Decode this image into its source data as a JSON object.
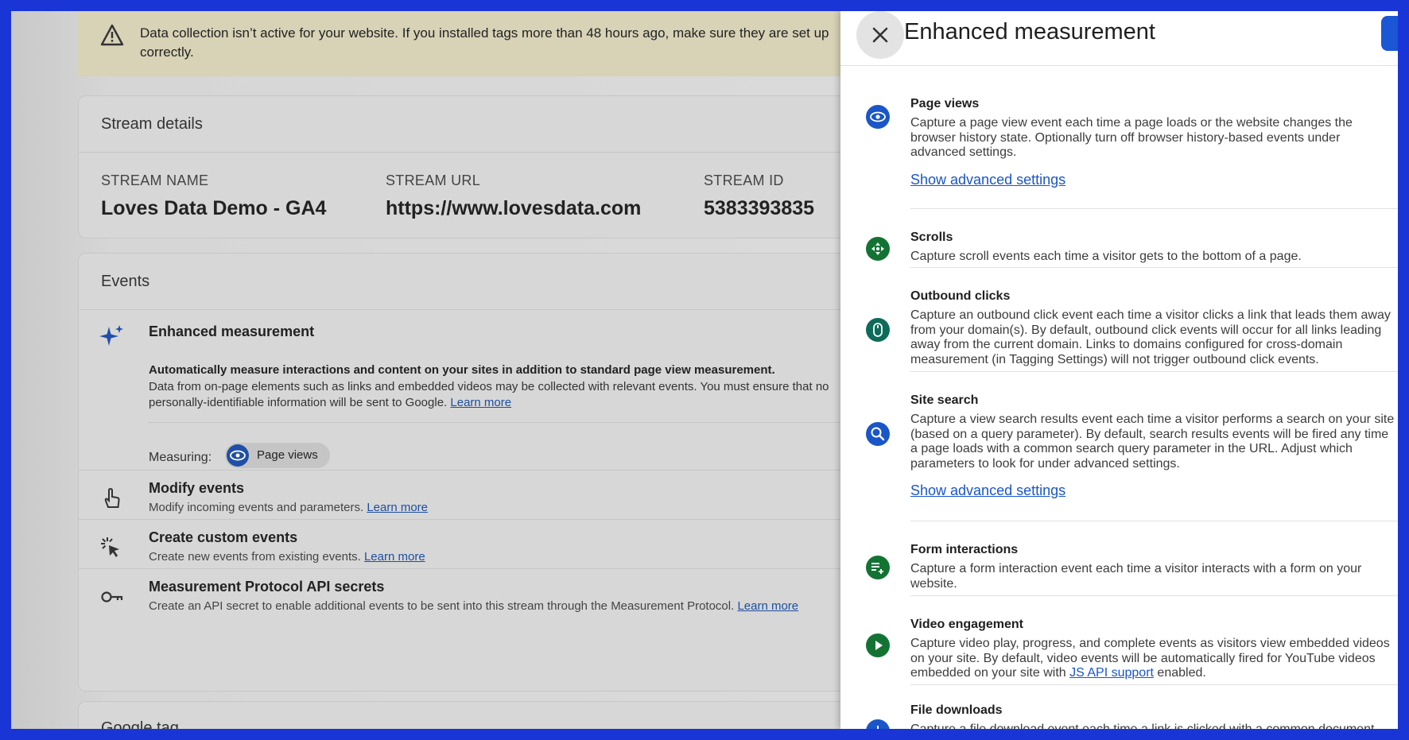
{
  "warning": {
    "text": "Data collection isn’t active for your website. If you installed tags more than 48 hours ago, make sure they are set up correctly."
  },
  "stream_details": {
    "title": "Stream details",
    "name_label": "STREAM NAME",
    "name_value": "Loves Data Demo - GA4",
    "url_label": "STREAM URL",
    "url_value": "https://www.lovesdata.com",
    "id_label": "STREAM ID",
    "id_value": "5383393835"
  },
  "events": {
    "title": "Events",
    "enhanced": {
      "title": "Enhanced measurement",
      "desc_bold": "Automatically measure interactions and content on your sites in addition to standard page view measurement.",
      "desc": "Data from on-page elements such as links and embedded videos may be collected with relevant events. You must ensure that no personally-identifiable information will be sent to Google.",
      "learn_more": "Learn more",
      "measuring_label": "Measuring:",
      "chip_label": "Page views"
    },
    "rows": [
      {
        "title": "Modify events",
        "desc": "Modify incoming events and parameters.",
        "link": "Learn more"
      },
      {
        "title": "Create custom events",
        "desc": "Create new events from existing events.",
        "link": "Learn more"
      },
      {
        "title": "Measurement Protocol API secrets",
        "desc": "Create an API secret to enable additional events to be sent into this stream through the Measurement Protocol.",
        "link": "Learn more"
      }
    ]
  },
  "google_tag": {
    "title": "Google tag"
  },
  "panel": {
    "title": "Enhanced measurement",
    "advanced_label": "Show advanced settings",
    "items": [
      {
        "title": "Page views",
        "desc": "Capture a page view event each time a page loads or the website changes the browser history state. Optionally turn off browser history-based events under advanced settings.",
        "icon": "eye-icon"
      },
      {
        "title": "Scrolls",
        "desc": "Capture scroll events each time a visitor gets to the bottom of a page.",
        "icon": "scroll-icon"
      },
      {
        "title": "Outbound clicks",
        "desc": "Capture an outbound click event each time a visitor clicks a link that leads them away from your domain(s). By default, outbound click events will occur for all links leading away from the current domain. Links to domains configured for cross-domain measurement (in Tagging Settings) will not trigger outbound click events.",
        "icon": "mouse-icon"
      },
      {
        "title": "Site search",
        "desc": "Capture a view search results event each time a visitor performs a search on your site (based on a query parameter). By default, search results events will be fired any time a page loads with a common search query parameter in the URL. Adjust which parameters to look for under advanced settings.",
        "icon": "search-icon"
      },
      {
        "title": "Form interactions",
        "desc": "Capture a form interaction event each time a visitor interacts with a form on your website.",
        "icon": "form-icon"
      },
      {
        "title": "Video engagement",
        "desc_pre": "Capture video play, progress, and complete events as visitors view embedded videos on your site. By default, video events will be automatically fired for YouTube videos embedded on your site with ",
        "desc_link": "JS API support",
        "desc_post": " enabled.",
        "icon": "play-icon"
      },
      {
        "title": "File downloads",
        "desc": "Capture a file download event each time a link is clicked with a common document,",
        "icon": "download-icon"
      }
    ]
  },
  "colors": {
    "accent_blue": "#1a56c8",
    "green": "#137333",
    "teal": "#0e6b5a",
    "frame_blue": "#1a35d6"
  }
}
